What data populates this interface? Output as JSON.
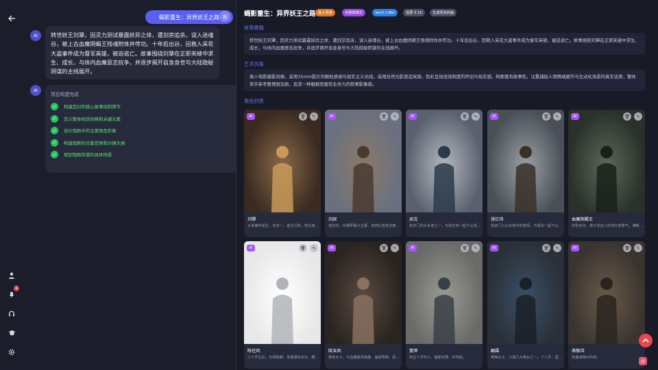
{
  "chat": {
    "user_bubble": "蝎影重生：异界妖王之路",
    "user_avatar": "我",
    "ai_avatar": "AI",
    "ai_message": "转世妖王刘犟，因灵力测试暴露妖异之体，遭剑宗追杀，误入迷魂谷，被上古血魔阴蝎王残魂附体并传功。十年后出谷，因救入采花大盗事件成为督军英雄，被迫逃亡。故事围绕刘犟在正邪夹缝中求生、成长，与体内血魔意志抗争，并逐步揭开自身身世与大陆隐秘阴谋的主线展开。",
    "progress_header": "项目构建完成",
    "steps": [
      "构建您对的核心故事线和情节",
      "定义整体视觉风格和关键元素",
      "设计短剧中的主要角色形象",
      "构建短剧的分集范例和分镜大纲",
      "规划短剧所需的具体场景"
    ]
  },
  "project": {
    "title": "蝎影重生：异界妖王之路",
    "tags": [
      {
        "label": "真人风格",
        "color": "#e0782a"
      },
      {
        "label": "多剧情模式",
        "color": "#9b4ae0"
      },
      {
        "label": "Veo3.1-Wei",
        "color": "#2b7fe0"
      },
      {
        "label": "竖屏 9:16",
        "color": "#4a4f63"
      },
      {
        "label": "生成项目封面",
        "color": "#4a4f63"
      }
    ],
    "story_section": "故事梗概",
    "story_text": "转世妖王刘犟，因灵力测试暴露妖异之体，遭剑宗追杀，误入迷魂谷，被上古血魔阴蝎王残魂附体并传功。十年后出谷，因救入采花大盗事件成为督军英雄，被迫逃亡。故事围绕刘犟在正邪夹缝中求生、成长，与体内血魔意志抗争，并逐步揭开自身身世与大陆隐秘阴谋的主线展开。",
    "style_section": "艺术风格",
    "style_text": "真人电影摄影风格，采用35mm胶片的颗粒质感与现实主义光线，采用自然光影营造氛围，色彩呈现低饱和度的怀旧与现实感。构图富有故事性，注重捕捉人物情绪细节与生动化场景的真实还原，整体美学参考赛博朋克剧，追求一种粗粝而富有生命力的叙事影像感。",
    "roles_section": "角色列表"
  },
  "characters": [
    {
      "name": "刘犟",
      "desc": "从采摘中诞生，本身一、金光闪烁，苦长成七八岁身高，嚼嘴的衣，赶着牛"
    },
    {
      "name": "刘叔",
      "desc": "老好花，珍稀罗爵冷主惠，佳肉比苦茶还被，几十年在牛村庄里，人们和他"
    },
    {
      "name": "吴沈",
      "desc": "剑宗门的大长老之一，与张亿伟一起下山测试灵力。"
    },
    {
      "name": "张亿伟",
      "desc": "剑宗门七大长老中的老师，与吴沈一起下山测试灵力。"
    },
    {
      "name": "血魔阴蝎王",
      "desc": "实则身无，枝子状远人形的红色雾气，满眼红光四射，下身有红色鳞"
    },
    {
      "name": "陈任风",
      "desc": "三十岁左右，长相俊朗，身着银色衣衫，腰佩属行霜金城宝剑，身材修长"
    },
    {
      "name": "晓玉凤",
      "desc": "佬色女子，与血魔者情绪鑫，面容明亮，肌肤，肚兜下穿醒霓裳，与刘犟"
    },
    {
      "name": "寞萍",
      "desc": "四五十岁妇人，面部刻薄，手持锐。"
    },
    {
      "name": "翩霖",
      "desc": "佬美女子，江湖几大美女之一，十八岁，透悟深人。"
    },
    {
      "name": "燕敬伟",
      "desc": "末度城等州外航。"
    }
  ],
  "badge_ai": "AI",
  "notif_count": "1",
  "colors": {
    "accent": "#5b5ff0",
    "success": "#22c55e",
    "section": "#6474ee",
    "danger": "#e5484d"
  }
}
